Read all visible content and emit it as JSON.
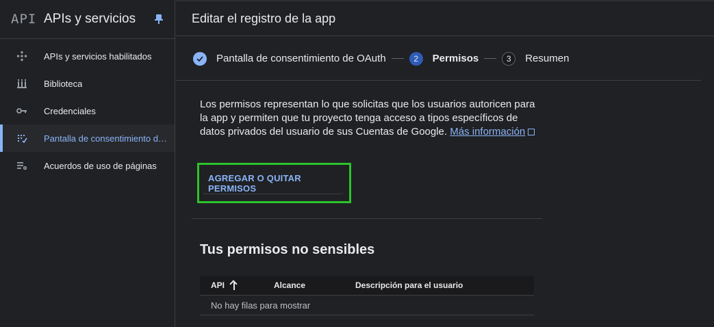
{
  "sidebar": {
    "logo": "API",
    "title": "APIs y servicios",
    "items": [
      {
        "label": "APIs y servicios habilitados",
        "icon": "diamond-dots-icon"
      },
      {
        "label": "Biblioteca",
        "icon": "library-icon"
      },
      {
        "label": "Credenciales",
        "icon": "key-icon"
      },
      {
        "label": "Pantalla de consentimiento de OAuth",
        "icon": "consent-grid-icon",
        "active": true
      },
      {
        "label": "Acuerdos de uso de páginas",
        "icon": "settings-list-icon"
      }
    ]
  },
  "header": {
    "title": "Editar el registro de la app"
  },
  "stepper": {
    "steps": [
      {
        "number": "",
        "label": "Pantalla de consentimiento de OAuth",
        "state": "done"
      },
      {
        "number": "2",
        "label": "Permisos",
        "state": "current"
      },
      {
        "number": "3",
        "label": "Resumen",
        "state": "todo"
      }
    ]
  },
  "main": {
    "description": "Los permisos representan lo que solicitas que los usuarios autoricen para la app y permiten que tu proyecto tenga acceso a tipos específicos de datos privados del usuario de sus Cuentas de Google.",
    "more_info_link": "Más información",
    "add_button": "AGREGAR O QUITAR PERMISOS",
    "section_title": "Tus permisos no sensibles",
    "table": {
      "columns": [
        "API",
        "Alcance",
        "Descripción para el usuario"
      ],
      "empty_text": "No hay filas para mostrar"
    }
  },
  "colors": {
    "accent": "#8ab4f8",
    "highlight_frame": "#2cc32c",
    "background": "#202124"
  }
}
